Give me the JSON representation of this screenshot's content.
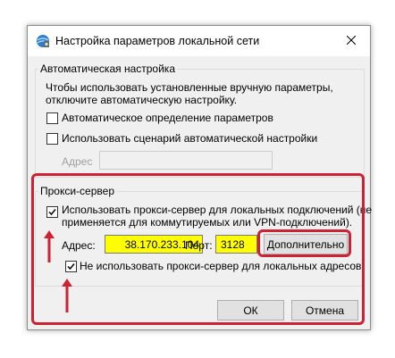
{
  "window": {
    "title": "Настройка параметров локальной сети",
    "icon": "network-settings-icon",
    "close_icon": "close-icon"
  },
  "auto_config": {
    "legend": "Автоматическая настройка",
    "description_line1": "Чтобы использовать установленные вручную параметры,",
    "description_line2": "отключите автоматическую настройку.",
    "auto_detect": {
      "label": "Автоматическое определение параметров",
      "checked": false
    },
    "use_script": {
      "label": "Использовать сценарий автоматической настройки",
      "checked": false
    },
    "address_label": "Адрес",
    "address_value": ""
  },
  "proxy": {
    "legend": "Прокси-сервер",
    "use_proxy": {
      "label_line1": "Использовать прокси-сервер для локальных подключений (не",
      "label_line2": "применяется для коммутируемых или VPN-подключений).",
      "checked": true
    },
    "address_label": "Адрес:",
    "address_value": "38.170.233.104",
    "port_label": "Порт:",
    "port_value": "3128",
    "advanced_button": "Дополнительно",
    "bypass_local": {
      "label": "Не использовать прокси-сервер для локальных адресов",
      "checked": true
    }
  },
  "buttons": {
    "ok": "ОК",
    "cancel": "Отмена"
  },
  "colors": {
    "highlight_red": "#cc2233",
    "field_highlight": "#ffff00",
    "dialog_bg": "#f0f0f0"
  }
}
